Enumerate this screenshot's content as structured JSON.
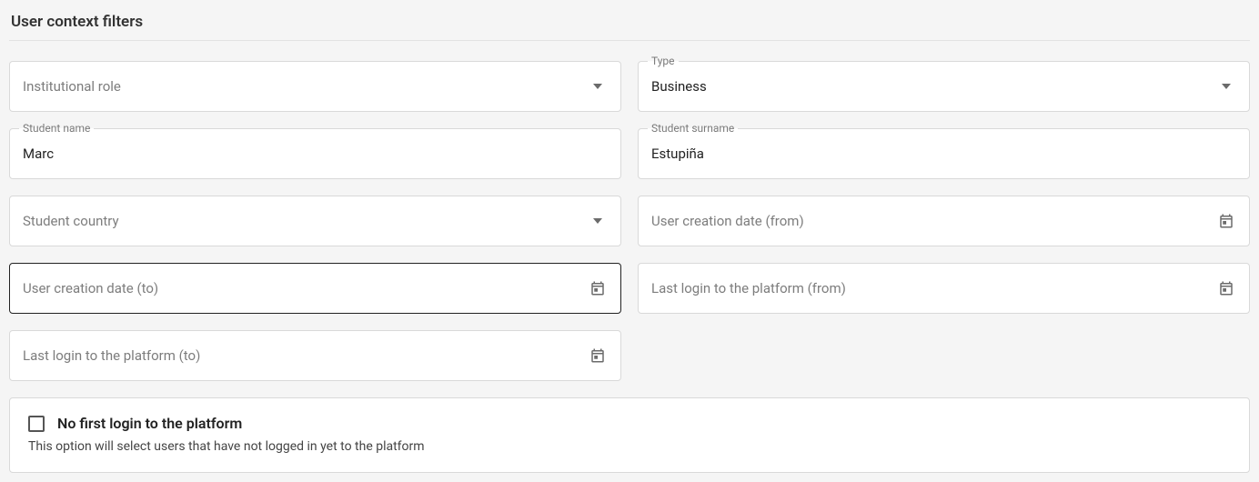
{
  "section_title": "User context filters",
  "fields": {
    "institutional_role": {
      "placeholder": "Institutional role",
      "value": ""
    },
    "type": {
      "float_label": "Type",
      "value": "Business"
    },
    "student_name": {
      "float_label": "Student name",
      "value": "Marc"
    },
    "student_surname": {
      "float_label": "Student surname",
      "value": "Estupiña"
    },
    "student_country": {
      "placeholder": "Student country",
      "value": ""
    },
    "creation_from": {
      "placeholder": "User creation date (from)",
      "value": ""
    },
    "creation_to": {
      "placeholder": "User creation date (to)",
      "value": ""
    },
    "login_from": {
      "placeholder": "Last login to the platform (from)",
      "value": ""
    },
    "login_to": {
      "placeholder": "Last login to the platform (to)",
      "value": ""
    }
  },
  "no_first_login": {
    "label": "No first login to the platform",
    "description": "This option will select users that have not logged in yet to the platform",
    "checked": false
  }
}
